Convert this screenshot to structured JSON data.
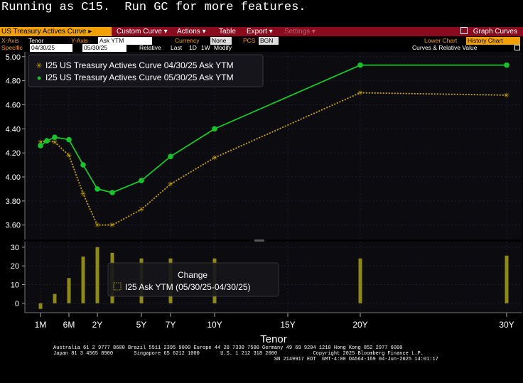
{
  "status_message": "Running as C15.  Run GC for more features.",
  "menubar": {
    "security": "US Treasury Actives Curve",
    "security_caret": "▸",
    "items": [
      "Custom Curve ▾",
      "Actions ▾",
      "Table",
      "Export ▾",
      "Settings ▾"
    ],
    "graph_curves": "Graph Curves"
  },
  "options_row1": {
    "xaxis_label": "X-Axis",
    "xaxis_value": "Tenor",
    "yaxis_label": "Y-Axis",
    "yaxis_value": "Ask YTM",
    "currency_label": "Currency",
    "currency_value": "None",
    "pcs_label": "PCS",
    "pcs_value": "BGN",
    "lower_chart_label": "Lower Chart",
    "lower_chart_value": "History Chart"
  },
  "options_row2": {
    "specific_label": "Specific",
    "date1": "04/30/25",
    "date2": "05/30/25",
    "relative_label": "Relative",
    "last_label": "Last",
    "btn_1d": "1D",
    "btn_1w": "1W",
    "modify_label": "Modify",
    "curves_label": "Curves & Relative Value"
  },
  "legend": [
    {
      "marker": "✳",
      "label": "I25 US Treasury Actives Curve 04/30/25 Ask YTM"
    },
    {
      "marker": "●",
      "label": "I25 US Treasury Actives Curve 05/30/25 Ask YTM"
    }
  ],
  "lower_legend": {
    "title": "Change",
    "label": "I25 Ask YTM (05/30/25-04/30/25)"
  },
  "xlabel": "Tenor",
  "colors": {
    "menubar": "#8a0a1e",
    "accent": "#f0a000",
    "curve_old": "#c9a500",
    "curve_new": "#17c52b",
    "bars": "#8f8a12",
    "grid": "#1e1e28"
  },
  "chart_data": [
    {
      "type": "line",
      "x_ticks": [
        "1M",
        "6M",
        "2Y",
        "5Y",
        "7Y",
        "10Y",
        "15Y",
        "20Y",
        "30Y"
      ],
      "y_ticks": [
        "3.60",
        "3.80",
        "4.00",
        "4.20",
        "4.40",
        "4.60",
        "4.80",
        "5.00"
      ],
      "ylim": [
        3.48,
        5.04
      ],
      "series": [
        {
          "name": "I25 US Treasury Actives Curve 04/30/25 Ask YTM",
          "x": [
            "1M",
            "2M",
            "3M",
            "6M",
            "1Y",
            "2Y",
            "3Y",
            "5Y",
            "7Y",
            "10Y",
            "20Y",
            "30Y"
          ],
          "values": [
            4.29,
            4.3,
            4.29,
            4.18,
            3.86,
            3.6,
            3.6,
            3.73,
            3.94,
            4.16,
            4.7,
            4.68
          ]
        },
        {
          "name": "I25 US Treasury Actives Curve 05/30/25 Ask YTM",
          "x": [
            "1M",
            "2M",
            "3M",
            "6M",
            "1Y",
            "2Y",
            "3Y",
            "5Y",
            "7Y",
            "10Y",
            "20Y",
            "30Y"
          ],
          "values": [
            4.26,
            4.3,
            4.33,
            4.31,
            4.1,
            3.9,
            3.87,
            3.97,
            4.17,
            4.4,
            4.93,
            4.93
          ]
        }
      ]
    },
    {
      "type": "bar",
      "y_ticks": [
        "0",
        "10",
        "20",
        "30"
      ],
      "ylim": [
        -5,
        33
      ],
      "series": [
        {
          "name": "I25 Ask YTM (05/30/25-04/30/25)",
          "x": [
            "1M",
            "2M",
            "3M",
            "6M",
            "1Y",
            "2Y",
            "3Y",
            "5Y",
            "7Y",
            "10Y",
            "20Y",
            "30Y"
          ],
          "values": [
            -3,
            0,
            5,
            13.5,
            25,
            30,
            27,
            24,
            24,
            24,
            24,
            25.5
          ]
        }
      ]
    }
  ],
  "footer": [
    "Australia 61 2 9777 8600 Brazil 5511 2395 9000 Europe 44 20 7330 7500 Germany 49 69 9204 1210 Hong Kong 852 2977 6000",
    "Japan 81 3 4565 8900       Singapore 65 6212 1000       U.S. 1 212 318 2000            Copyright 2025 Bloomberg Finance L.P.",
    "                                                                          SN 2149917 EDT  GMT-4:00 DA564-169 04-Jun-2025 14:01:17"
  ]
}
